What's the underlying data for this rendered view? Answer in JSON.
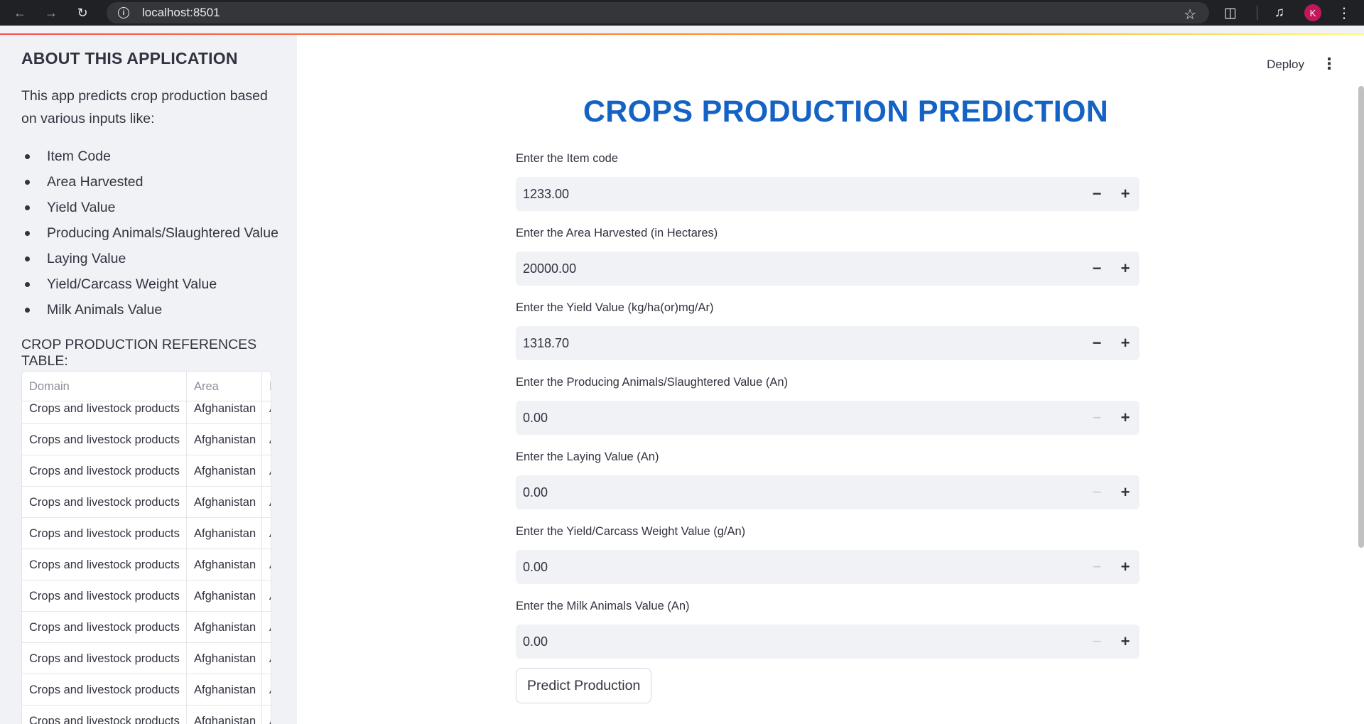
{
  "browser": {
    "url": "localhost:8501",
    "avatar_letter": "K"
  },
  "toolbar": {
    "deploy_label": "Deploy"
  },
  "sidebar": {
    "title": "ABOUT THIS APPLICATION",
    "description": "This app predicts crop production based on various inputs like:",
    "items": [
      "Item Code",
      "Area Harvested",
      "Yield Value",
      "Producing Animals/Slaughtered Value",
      "Laying Value",
      "Yield/Carcass Weight Value",
      "Milk Animals Value"
    ],
    "table_heading": "CROP PRODUCTION REFERENCES TABLE:",
    "table": {
      "columns": [
        "Domain",
        "Area",
        "I"
      ],
      "rows": [
        [
          "Crops and livestock products",
          "Afghanistan",
          "A"
        ],
        [
          "Crops and livestock products",
          "Afghanistan",
          "A"
        ],
        [
          "Crops and livestock products",
          "Afghanistan",
          "A"
        ],
        [
          "Crops and livestock products",
          "Afghanistan",
          "A"
        ],
        [
          "Crops and livestock products",
          "Afghanistan",
          "A"
        ],
        [
          "Crops and livestock products",
          "Afghanistan",
          "A"
        ],
        [
          "Crops and livestock products",
          "Afghanistan",
          "A"
        ],
        [
          "Crops and livestock products",
          "Afghanistan",
          "A"
        ],
        [
          "Crops and livestock products",
          "Afghanistan",
          "A"
        ],
        [
          "Crops and livestock products",
          "Afghanistan",
          "A"
        ],
        [
          "Crops and livestock products",
          "Afghanistan",
          "A"
        ]
      ]
    }
  },
  "main": {
    "title": "CROPS PRODUCTION PREDICTION",
    "fields": [
      {
        "label": "Enter the Item code",
        "value": "1233.00",
        "minus_disabled": false
      },
      {
        "label": "Enter the Area Harvested (in Hectares)",
        "value": "20000.00",
        "minus_disabled": false
      },
      {
        "label": "Enter the Yield Value (kg/ha(or)mg/Ar)",
        "value": "1318.70",
        "minus_disabled": false
      },
      {
        "label": "Enter the Producing Animals/Slaughtered Value (An)",
        "value": "0.00",
        "minus_disabled": true
      },
      {
        "label": "Enter the Laying Value (An)",
        "value": "0.00",
        "minus_disabled": true
      },
      {
        "label": "Enter the Yield/Carcass Weight Value (g/An)",
        "value": "0.00",
        "minus_disabled": true
      },
      {
        "label": "Enter the Milk Animals Value (An)",
        "value": "0.00",
        "minus_disabled": true
      }
    ],
    "predict_label": "Predict Production"
  },
  "colors": {
    "title_blue": "#1463c4",
    "sidebar_bg": "#f0f2f6",
    "input_bg": "#f0f2f6"
  }
}
